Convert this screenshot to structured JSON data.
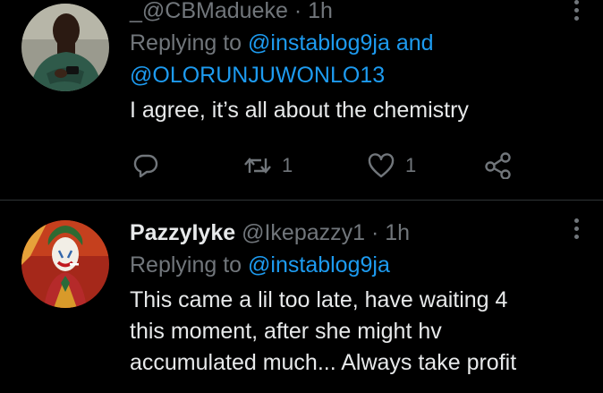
{
  "tweets": [
    {
      "display_name": "",
      "handle": "_@CBMadueke",
      "dot": "·",
      "time": "1h",
      "replying_prefix": "Replying to",
      "mentions": [
        "@instablog9ja",
        "@OLORUNJUWONLO13"
      ],
      "and_text": "and",
      "text": "I agree, it’s all about the chemistry",
      "reply_count": "",
      "retweet_count": "1",
      "like_count": "1"
    },
    {
      "display_name": "PazzyIyke",
      "handle": "@Ikepazzy1",
      "dot": "·",
      "time": "1h",
      "replying_prefix": "Replying to",
      "mentions": [
        "@instablog9ja"
      ],
      "text_lines": [
        "This came a lil too late, have waiting 4",
        "this moment, after she might hv",
        "accumulated much... Always take profit"
      ]
    }
  ],
  "icons": {
    "reply": "reply-icon",
    "retweet": "retweet-icon",
    "like": "heart-icon",
    "share": "share-icon",
    "more": "more-vertical-icon"
  },
  "colors": {
    "background": "#000000",
    "text": "#e7e9ea",
    "secondary": "#71767b",
    "link": "#1d9bf0",
    "divider": "#2f3336"
  }
}
